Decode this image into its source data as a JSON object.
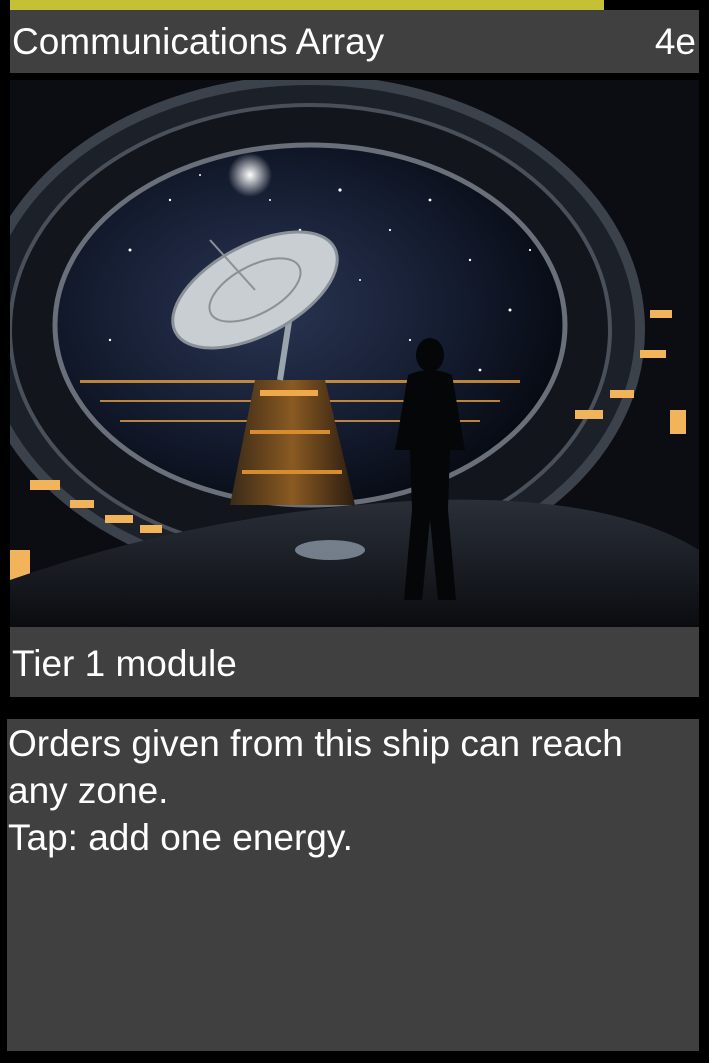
{
  "card": {
    "name": "Communications Array",
    "cost": "4e",
    "type_line": "Tier 1 module",
    "rules_text": [
      "Orders given from this ship can reach",
      "any zone.",
      "Tap: add one energy."
    ]
  },
  "art": {
    "icon": "space-station-observation-window-artwork"
  },
  "colors": {
    "accent_bar": "#c4c234",
    "panel": "#404040",
    "background": "#000000",
    "text": "#ffffff"
  }
}
